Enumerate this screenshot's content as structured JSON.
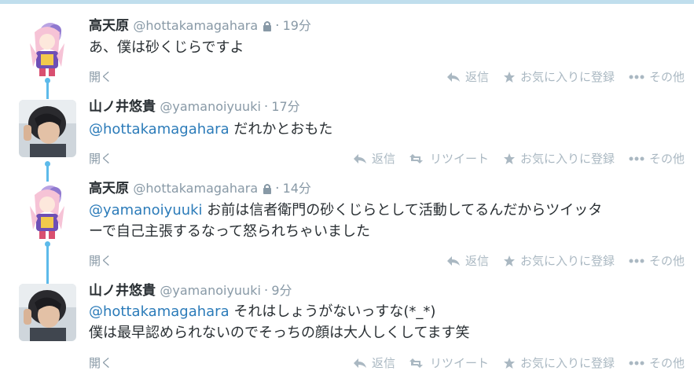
{
  "colors": {
    "accent": "#2b7bb9",
    "connector": "#5dbaea",
    "muted": "#8899a6",
    "action": "#aab8c2",
    "top_border": "#c0deed"
  },
  "actions": {
    "reply": "返信",
    "retweet": "リツイート",
    "favorite": "お気に入りに登録",
    "more": "その他",
    "expand": "開く"
  },
  "tweets": [
    {
      "name": "高天原",
      "handle": "@hottakamagahara",
      "protected": true,
      "time": "19分",
      "mention": "",
      "text_line1": "あ、僕は砂くじらですよ",
      "text_line2": "",
      "avatar": "anime-girl-avatar",
      "has_retweet": false
    },
    {
      "name": "山ノ井悠貴",
      "handle": "@yamanoiyuuki",
      "protected": false,
      "time": "17分",
      "mention": "@hottakamagahara",
      "text_line1": " だれかとおもた",
      "text_line2": "",
      "avatar": "person-photo-avatar",
      "has_retweet": true
    },
    {
      "name": "高天原",
      "handle": "@hottakamagahara",
      "protected": true,
      "time": "14分",
      "mention": "@yamanoiyuuki",
      "text_line1": " お前は信者衛門の砂くじらとして活動してるんだからツイッタ",
      "text_line2": "ーで自己主張するなって怒られちゃいました",
      "avatar": "anime-girl-avatar",
      "has_retweet": false
    },
    {
      "name": "山ノ井悠貴",
      "handle": "@yamanoiyuuki",
      "protected": false,
      "time": "9分",
      "mention": "@hottakamagahara",
      "text_line1": " それはしょうがないっすな(*_*)",
      "text_line2": "僕は最早認められないのでそっちの顔は大人しくしてます笑",
      "avatar": "person-photo-avatar",
      "has_retweet": true
    }
  ]
}
